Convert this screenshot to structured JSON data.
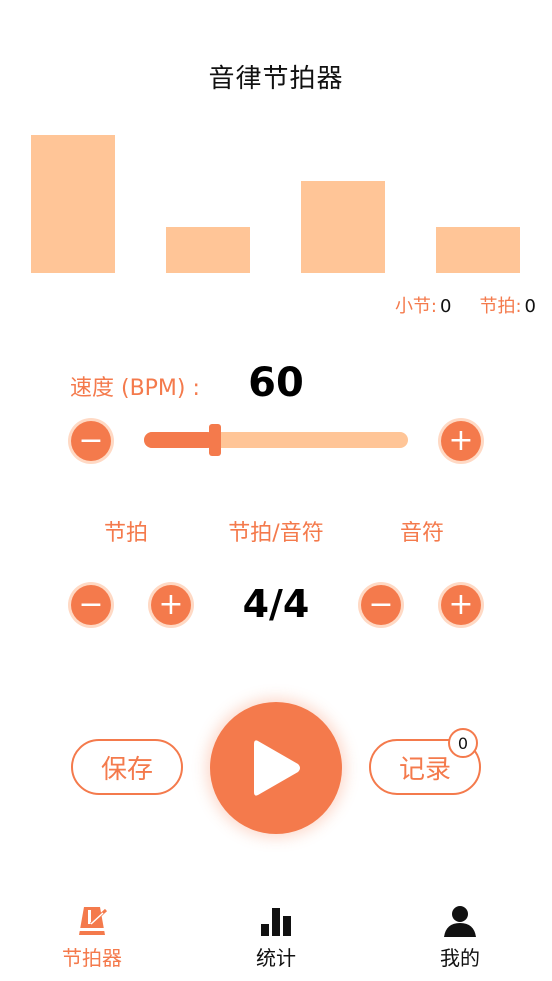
{
  "app": {
    "title": "音律节拍器"
  },
  "beats": {
    "levels": [
      1.0,
      0.33,
      0.67,
      0.33
    ],
    "color": "#FFC597"
  },
  "counters": {
    "measure_label": "小节:",
    "measure_value": "0",
    "beat_label": "节拍:",
    "beat_value": "0"
  },
  "tempo": {
    "label": "速度 (BPM) :",
    "value": "60",
    "slider_fraction": 0.27,
    "minus_glyph": "−",
    "plus_glyph": "+"
  },
  "time_signature": {
    "beats_label": "节拍",
    "ratio_label": "节拍/音符",
    "note_label": "音符",
    "value": "4/4",
    "minus_glyph": "−",
    "plus_glyph": "+"
  },
  "actions": {
    "save_label": "保存",
    "record_label": "记录",
    "record_count": "0",
    "play_icon": "play-icon"
  },
  "nav": {
    "items": [
      {
        "label": "节拍器",
        "icon": "metronome-icon",
        "active": true
      },
      {
        "label": "统计",
        "icon": "bar-chart-icon",
        "active": false
      },
      {
        "label": "我的",
        "icon": "person-icon",
        "active": false
      }
    ]
  },
  "colors": {
    "accent": "#F47A4C",
    "accent_light": "#FFC597",
    "text_dark": "#111111"
  }
}
